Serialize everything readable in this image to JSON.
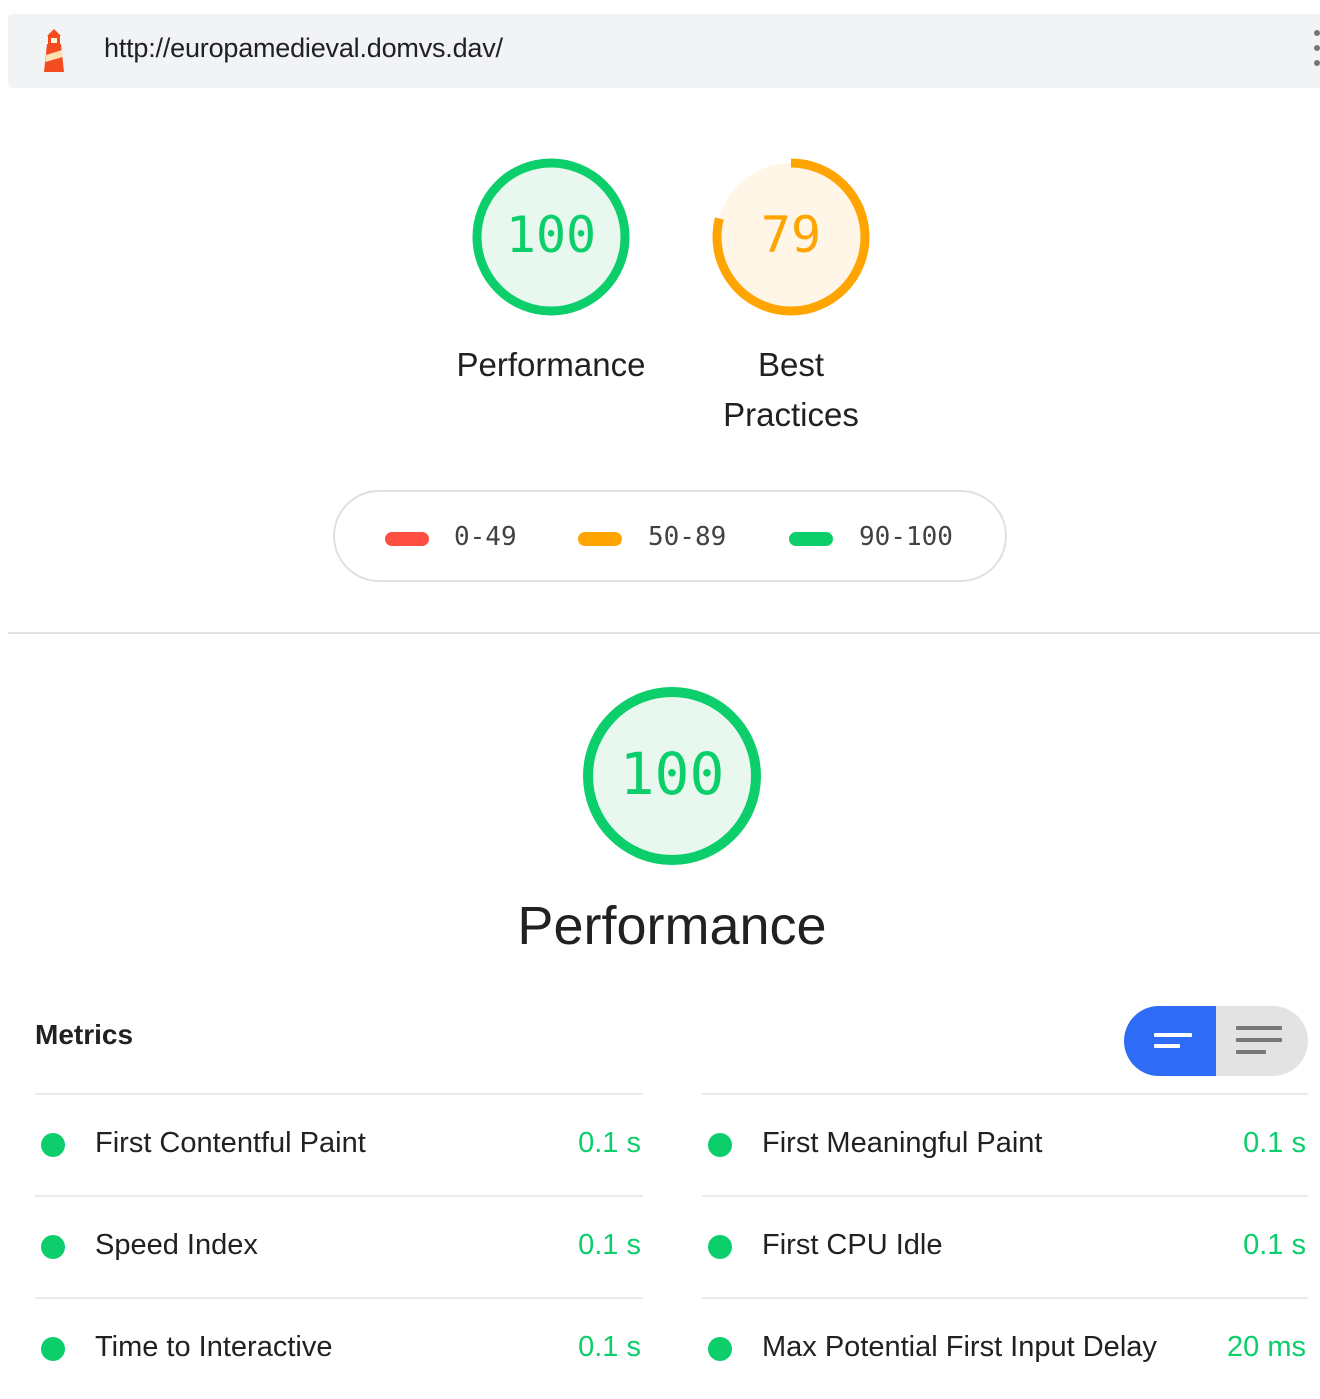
{
  "header": {
    "url": "http://europamedieval.domvs.dav/",
    "logo_icon": "lighthouse-icon",
    "menu_icon": "kebab-menu-icon"
  },
  "gauges": [
    {
      "label": "Performance",
      "score": 100,
      "color": "#0cce6b",
      "bg": "#e9f8ef"
    },
    {
      "label_line1": "Best",
      "label_line2": "Practices",
      "score": 79,
      "color": "#ffa400",
      "bg": "#fff6e7"
    }
  ],
  "legend": [
    {
      "range": "0-49",
      "color": "#ff4e42"
    },
    {
      "range": "50-89",
      "color": "#ffa400"
    },
    {
      "range": "90-100",
      "color": "#0cce6b"
    }
  ],
  "category": {
    "title": "Performance",
    "score": 100,
    "color": "#0cce6b"
  },
  "metrics": {
    "title": "Metrics",
    "toggle": {
      "left_icon": "compact-view-icon",
      "right_icon": "expanded-view-icon"
    },
    "left": [
      {
        "name": "First Contentful Paint",
        "value": "0.1 s"
      },
      {
        "name": "Speed Index",
        "value": "0.1 s"
      },
      {
        "name": "Time to Interactive",
        "value": "0.1 s"
      }
    ],
    "right": [
      {
        "name": "First Meaningful Paint",
        "value": "0.1 s"
      },
      {
        "name": "First CPU Idle",
        "value": "0.1 s"
      },
      {
        "name": "Max Potential First Input Delay",
        "value": "20 ms"
      }
    ]
  }
}
